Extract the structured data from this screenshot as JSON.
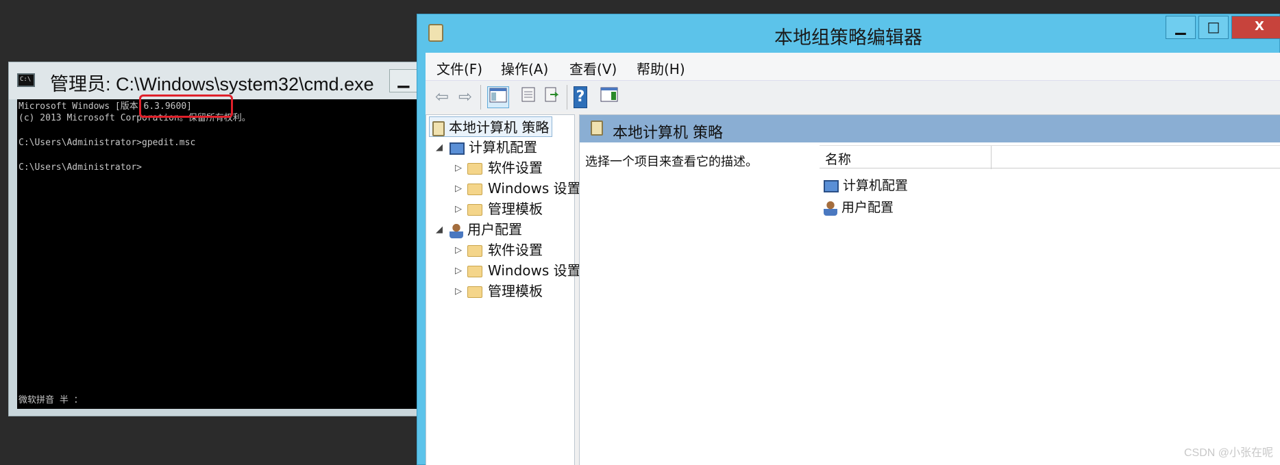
{
  "cmd": {
    "title": "管理员: C:\\Windows\\system32\\cmd.exe",
    "min_btn": "▁",
    "lines": [
      "Microsoft Windows [版本 6.3.9600]",
      "(c) 2013 Microsoft Corporation。保留所有权利。",
      "C:\\Users\\Administrator>gpedit.msc",
      "C:\\Users\\Administrator>"
    ],
    "ime_status": "微软拼音 半 ：",
    "highlight_color": "#e0202a"
  },
  "gpedit": {
    "title": "本地组策略编辑器",
    "window_buttons": {
      "min": "▁",
      "max": "□",
      "close": "X"
    },
    "menu": [
      "文件(F)",
      "操作(A)",
      "查看(V)",
      "帮助(H)"
    ],
    "toolbar": {
      "back": "⇦",
      "forward": "⇨",
      "help": "?"
    },
    "tree": {
      "root": "本地计算机 策略",
      "computer": "计算机配置",
      "computer_children": [
        "软件设置",
        "Windows 设置",
        "管理模板"
      ],
      "user": "用户配置",
      "user_children": [
        "软件设置",
        "Windows 设置",
        "管理模板"
      ]
    },
    "pane": {
      "header": "本地计算机 策略",
      "description": "选择一个项目来查看它的描述。",
      "column_name": "名称",
      "items": [
        "计算机配置",
        "用户配置"
      ]
    }
  },
  "watermark": "CSDN @小张在呢",
  "colors": {
    "title_bar": "#5cc3ea",
    "close": "#c7433c",
    "pane_header": "#8aaed3"
  }
}
